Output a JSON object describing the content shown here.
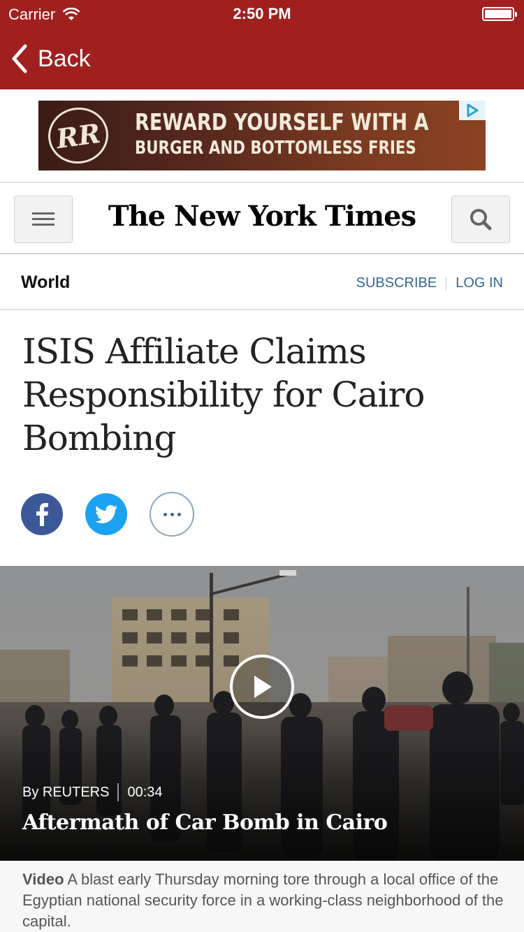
{
  "status_bar": {
    "carrier": "Carrier",
    "time": "2:50 PM"
  },
  "nav": {
    "back_label": "Back"
  },
  "ad": {
    "logo_text": "RR",
    "line1": "REWARD YOURSELF WITH A",
    "line2": "BURGER AND BOTTOMLESS FRIES"
  },
  "masthead": {
    "logo": "The New York Times"
  },
  "section": {
    "name": "World",
    "subscribe": "SUBSCRIBE",
    "login": "LOG IN"
  },
  "article": {
    "headline": "ISIS Affiliate Claims Responsibility for Cairo Bombing"
  },
  "video": {
    "byline": "By REUTERS",
    "duration": "00:34",
    "title": "Aftermath of Car Bomb in Cairo",
    "caption_label": "Video",
    "caption_text": " A blast early Thursday morning tore through a local office of the Egyptian national security force in a working-class neighborhood of the capital."
  },
  "colors": {
    "nav_bar": "#a0201f",
    "link": "#326891",
    "facebook": "#3b5998",
    "twitter": "#1da1f2"
  },
  "icons": [
    "wifi-icon",
    "battery-icon",
    "back-chevron-icon",
    "adchoices-icon",
    "menu-icon",
    "search-icon",
    "facebook-icon",
    "twitter-icon",
    "more-icon",
    "play-icon"
  ]
}
